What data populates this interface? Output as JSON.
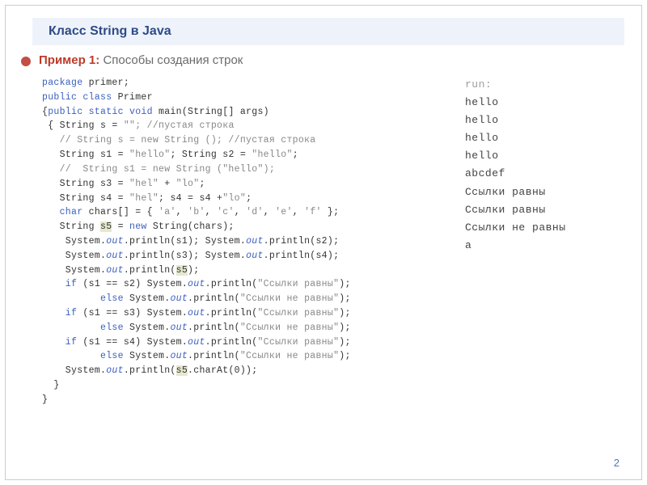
{
  "header": {
    "title": "Класс  String в Java"
  },
  "example": {
    "label": "Пример 1: ",
    "desc": "Способы создания строк"
  },
  "code": {
    "l01_pkg": "package",
    "l01_rest": " primer;",
    "l02_pub": "public class",
    "l02_rest": " Primer",
    "l03_open": "{",
    "l03_pub": "public static void",
    "l03_main": " main(String[] args)",
    "l04_open": " { String s = ",
    "l04_str": "\"\"",
    "l04_cmt": "; //пустая строка",
    "l05_cmt": "   // String s = new String (); //пустая строка",
    "l06a": "   String s1 = ",
    "l06a_str": "\"hello\"",
    "l06b": "; String s2 = ",
    "l06b_str": "\"hello\"",
    "l06c": ";",
    "l07_cmt": "   //  String s1 = new String (\"hello\");",
    "l08a": "   String s3 = ",
    "l08a_str": "\"hel\"",
    "l08b": " + ",
    "l08b_str": "\"lo\"",
    "l08c": ";",
    "l09a": "   String s4 = ",
    "l09a_str": "\"hel\"",
    "l09b": "; s4 = s4 +",
    "l09b_str": "\"lo\"",
    "l09c": ";",
    "l10_char": "   char",
    "l10a": " chars[] = { ",
    "l10_s1": "'a'",
    "l10_c1": ", ",
    "l10_s2": "'b'",
    "l10_c2": ", ",
    "l10_s3": "'c'",
    "l10_c3": ", ",
    "l10_s4": "'d'",
    "l10_c4": ", ",
    "l10_s5": "'e'",
    "l10_c5": ", ",
    "l10_s6": "'f'",
    "l10_end": " };",
    "l11a": "   String ",
    "l11_hl": "s5",
    "l11b": " = ",
    "l11_new": "new",
    "l11c": " String(chars);",
    "l12a": "    System.",
    "l12_out1": "out",
    "l12b": ".println(s1); System.",
    "l12_out2": "out",
    "l12c": ".println(s2);",
    "l13a": "    System.",
    "l13_out1": "out",
    "l13b": ".println(s3); System.",
    "l13_out2": "out",
    "l13c": ".println(s4);",
    "l14a": "    System.",
    "l14_out": "out",
    "l14b": ".println(",
    "l14_hl": "s5",
    "l14c": ");",
    "l15_if": "    if",
    "l15a": " (s1 == s2) System.",
    "l15_out": "out",
    "l15b": ".println(",
    "l15_str": "\"Ссылки равны\"",
    "l15c": ");",
    "l16_else": "          else",
    "l16a": " System.",
    "l16_out": "out",
    "l16b": ".println(",
    "l16_str": "\"Ссылки не равны\"",
    "l16c": ");",
    "l17_if": "    if",
    "l17a": " (s1 == s3) System.",
    "l17_out": "out",
    "l17b": ".println(",
    "l17_str": "\"Ссылки равны\"",
    "l17c": ");",
    "l18_else": "          else",
    "l18a": " System.",
    "l18_out": "out",
    "l18b": ".println(",
    "l18_str": "\"Ссылки не равны\"",
    "l18c": ");",
    "l19_if": "    if",
    "l19a": " (s1 == s4) System.",
    "l19_out": "out",
    "l19b": ".println(",
    "l19_str": "\"Ссылки равны\"",
    "l19c": ");",
    "l20_else": "          else",
    "l20a": " System.",
    "l20_out": "out",
    "l20b": ".println(",
    "l20_str": "\"Ссылки не равны\"",
    "l20c": ");",
    "l21a": "    System.",
    "l21_out": "out",
    "l21b": ".println(",
    "l21_hl": "s5",
    "l21c": ".charAt(0));",
    "l22": "  }",
    "l23": "}"
  },
  "output": {
    "run": "run:",
    "o1": "hello",
    "o2": "hello",
    "o3": "hello",
    "o4": "hello",
    "o5": "abcdef",
    "o6": "Ссылки равны",
    "o7": "Ссылки равны",
    "o8": "Ссылки не равны",
    "o9": "a"
  },
  "page": "2"
}
